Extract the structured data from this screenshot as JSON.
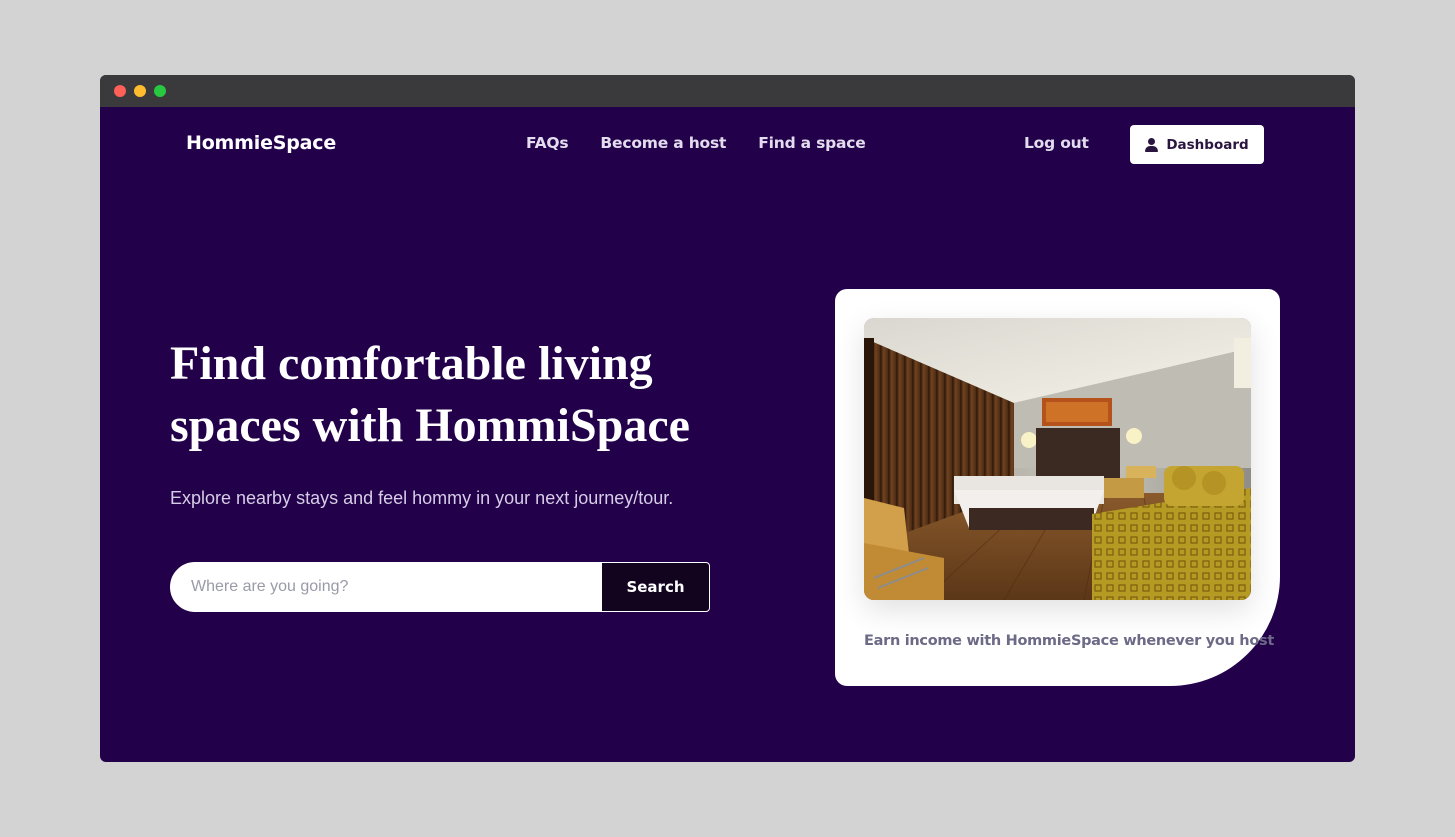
{
  "brand": {
    "name": "HommieSpace"
  },
  "nav": {
    "items": [
      {
        "label": "FAQs"
      },
      {
        "label": "Become a host"
      },
      {
        "label": "Find a space"
      }
    ],
    "logout_label": "Log out",
    "dashboard_label": "Dashboard"
  },
  "hero": {
    "title": "Find comfortable living spaces with HommiSpace",
    "subtitle": "Explore nearby stays and feel hommy in your next journey/tour.",
    "search_placeholder": "Where are you going?",
    "search_value": "",
    "search_button_label": "Search"
  },
  "card": {
    "caption": "Earn income with HommieSpace whenever you host"
  },
  "colors": {
    "page_background": "#22004a",
    "search_button": "#12031f",
    "card_caption": "#6c6a86"
  },
  "icons": {
    "dashboard": "user-icon"
  }
}
